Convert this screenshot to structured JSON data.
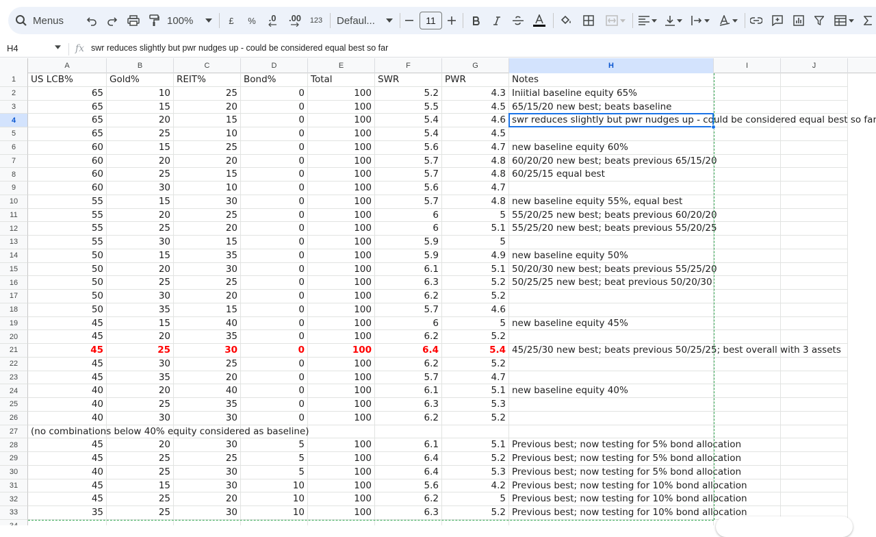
{
  "toolbar": {
    "menus_label": "Menus",
    "zoom_value": "100%",
    "currency_label": "£",
    "percent_label": "%",
    "decrease_decimals_label": ".0",
    "increase_decimals_label": ".00",
    "number_format_label": "123",
    "font_family": "Defaul...",
    "font_size": "11",
    "icons": [
      "search-icon",
      "undo-icon",
      "redo-icon",
      "print-icon",
      "paint-format-icon",
      "chevron-down-icon",
      "minus-icon",
      "plus-icon",
      "bold-icon",
      "italic-icon",
      "strikethrough-icon",
      "text-color-icon",
      "fill-color-icon",
      "borders-icon",
      "merge-cells-icon",
      "horizontal-align-icon",
      "vertical-align-icon",
      "text-wrapping-icon",
      "text-rotation-icon",
      "link-icon",
      "comment-icon",
      "chart-icon",
      "filter-icon",
      "table-icon",
      "functions-icon"
    ]
  },
  "formula_bar": {
    "name_box": "H4",
    "fx_label": "fx",
    "formula": "swr reduces slightly but pwr nudges up - could be considered equal best so far"
  },
  "columns": [
    "A",
    "B",
    "C",
    "D",
    "E",
    "F",
    "G",
    "H",
    "I",
    "J"
  ],
  "selected_cell": "H4",
  "highlight_color": "#ff0000",
  "rows": [
    {
      "n": "1",
      "cells": [
        "US LCB%",
        "Gold%",
        "REIT%",
        "Bond%",
        "Total",
        "SWR",
        "PWR",
        "Notes"
      ]
    },
    {
      "n": "2",
      "cells": [
        "65",
        "10",
        "25",
        "0",
        "100",
        "5.2",
        "4.3",
        "Iniitial baseline equity 65%"
      ]
    },
    {
      "n": "3",
      "cells": [
        "65",
        "15",
        "20",
        "0",
        "100",
        "5.5",
        "4.5",
        "65/15/20 new best; beats baseline"
      ]
    },
    {
      "n": "4",
      "cells": [
        "65",
        "20",
        "15",
        "0",
        "100",
        "5.4",
        "4.6",
        "swr reduces slightly but pwr nudges up - could be considered equal best so far"
      ]
    },
    {
      "n": "5",
      "cells": [
        "65",
        "25",
        "10",
        "0",
        "100",
        "5.4",
        "4.5",
        ""
      ]
    },
    {
      "n": "6",
      "cells": [
        "60",
        "15",
        "25",
        "0",
        "100",
        "5.6",
        "4.7",
        "new baseline equity 60%"
      ]
    },
    {
      "n": "7",
      "cells": [
        "60",
        "20",
        "20",
        "0",
        "100",
        "5.7",
        "4.8",
        "60/20/20 new best; beats previous 65/15/20"
      ]
    },
    {
      "n": "8",
      "cells": [
        "60",
        "25",
        "15",
        "0",
        "100",
        "5.7",
        "4.8",
        "60/25/15 equal best"
      ]
    },
    {
      "n": "9",
      "cells": [
        "60",
        "30",
        "10",
        "0",
        "100",
        "5.6",
        "4.7",
        ""
      ]
    },
    {
      "n": "10",
      "cells": [
        "55",
        "15",
        "30",
        "0",
        "100",
        "5.7",
        "4.8",
        "new baseline equity 55%, equal best"
      ]
    },
    {
      "n": "11",
      "cells": [
        "55",
        "20",
        "25",
        "0",
        "100",
        "6",
        "5",
        "55/20/25 new best; beats previous 60/20/20"
      ]
    },
    {
      "n": "12",
      "cells": [
        "55",
        "25",
        "20",
        "0",
        "100",
        "6",
        "5.1",
        "55/25/20 new best; beats previous 55/20/25"
      ]
    },
    {
      "n": "13",
      "cells": [
        "55",
        "30",
        "15",
        "0",
        "100",
        "5.9",
        "5",
        ""
      ]
    },
    {
      "n": "14",
      "cells": [
        "50",
        "15",
        "35",
        "0",
        "100",
        "5.9",
        "4.9",
        "new baseline equity 50%"
      ]
    },
    {
      "n": "15",
      "cells": [
        "50",
        "20",
        "30",
        "0",
        "100",
        "6.1",
        "5.1",
        "50/20/30 new best; beats previous 55/25/20"
      ]
    },
    {
      "n": "16",
      "cells": [
        "50",
        "25",
        "25",
        "0",
        "100",
        "6.3",
        "5.2",
        "50/25/25 new best; beat previous 50/20/30"
      ]
    },
    {
      "n": "17",
      "cells": [
        "50",
        "30",
        "20",
        "0",
        "100",
        "6.2",
        "5.2",
        ""
      ]
    },
    {
      "n": "18",
      "cells": [
        "50",
        "35",
        "15",
        "0",
        "100",
        "5.7",
        "4.6",
        ""
      ]
    },
    {
      "n": "19",
      "cells": [
        "45",
        "15",
        "40",
        "0",
        "100",
        "6",
        "5",
        "new baseline equity 45%"
      ]
    },
    {
      "n": "20",
      "cells": [
        "45",
        "20",
        "35",
        "0",
        "100",
        "6.2",
        "5.2",
        ""
      ]
    },
    {
      "n": "21",
      "cells": [
        "45",
        "25",
        "30",
        "0",
        "100",
        "6.4",
        "5.4",
        "45/25/30 new best; beats previous 50/25/25; best overall with 3 assets"
      ],
      "highlight": true
    },
    {
      "n": "22",
      "cells": [
        "45",
        "30",
        "25",
        "0",
        "100",
        "6.2",
        "5.2",
        ""
      ]
    },
    {
      "n": "23",
      "cells": [
        "45",
        "35",
        "20",
        "0",
        "100",
        "5.7",
        "4.7",
        ""
      ]
    },
    {
      "n": "24",
      "cells": [
        "40",
        "20",
        "40",
        "0",
        "100",
        "6.1",
        "5.1",
        "new baseline equity 40%"
      ]
    },
    {
      "n": "25",
      "cells": [
        "40",
        "25",
        "35",
        "0",
        "100",
        "6.3",
        "5.3",
        ""
      ]
    },
    {
      "n": "26",
      "cells": [
        "40",
        "30",
        "30",
        "0",
        "100",
        "6.2",
        "5.2",
        ""
      ]
    },
    {
      "n": "27",
      "cells": [
        "(no combinations below 40% equity considered as baseline)",
        "",
        "",
        "",
        "",
        "",
        "",
        ""
      ],
      "spanText": true
    },
    {
      "n": "28",
      "cells": [
        "45",
        "20",
        "30",
        "5",
        "100",
        "6.1",
        "5.1",
        "Previous best; now testing for 5% bond allocation"
      ]
    },
    {
      "n": "29",
      "cells": [
        "45",
        "25",
        "25",
        "5",
        "100",
        "6.4",
        "5.2",
        "Previous best; now testing for 5% bond allocation"
      ]
    },
    {
      "n": "30",
      "cells": [
        "40",
        "25",
        "30",
        "5",
        "100",
        "6.4",
        "5.3",
        "Previous best; now testing for 5% bond allocation"
      ]
    },
    {
      "n": "31",
      "cells": [
        "45",
        "15",
        "30",
        "10",
        "100",
        "5.6",
        "4.2",
        "Previous best; now testing for 10% bond allocation"
      ]
    },
    {
      "n": "32",
      "cells": [
        "45",
        "25",
        "20",
        "10",
        "100",
        "6.2",
        "5",
        "Previous best; now testing for 10% bond allocation"
      ]
    },
    {
      "n": "33",
      "cells": [
        "35",
        "25",
        "30",
        "10",
        "100",
        "6.3",
        "5.2",
        "Previous best; now testing for 10% bond allocation"
      ]
    },
    {
      "n": "34",
      "cells": [
        "",
        "",
        "",
        "",
        "",
        "",
        "",
        ""
      ]
    }
  ]
}
